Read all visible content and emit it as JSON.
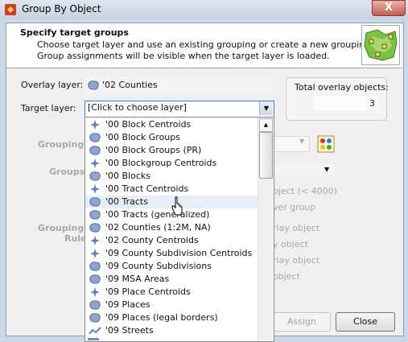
{
  "window": {
    "title": "Group By Object",
    "close_glyph": "X"
  },
  "header": {
    "title": "Specify target groups",
    "line1": "Choose target layer and use an existing grouping or create a new grouping.",
    "line2": "Group assignments will be visible when the target layer is loaded.",
    "icon": "map-grouping-icon"
  },
  "overlay": {
    "label": "Overlay layer:",
    "value": "'02 Counties",
    "icon": "polygon-layer-icon"
  },
  "total": {
    "label": "Total overlay objects:",
    "value": "3"
  },
  "target": {
    "label": "Target layer:",
    "value": "[Click to choose layer]"
  },
  "behind": {
    "grouping_label": "Grouping",
    "groups_label": "Groups",
    "grouping_rules_label1": "Grouping",
    "grouping_rules_label2": "Rule",
    "opt1": "bject (< 4000)",
    "opt2": "ver group",
    "opt3": "rlay object",
    "opt4": "y object",
    "opt5": "rlay object",
    "opt6": "object"
  },
  "layer_list": [
    {
      "label": "'00 Block Centroids",
      "icon": "point-layer-icon",
      "selected": false
    },
    {
      "label": "'00 Block Groups",
      "icon": "polygon-layer-icon",
      "selected": false
    },
    {
      "label": "'00 Block Groups (PR)",
      "icon": "polygon-layer-icon",
      "selected": false
    },
    {
      "label": "'00 Blockgroup Centroids",
      "icon": "point-layer-icon",
      "selected": false
    },
    {
      "label": "'00 Blocks",
      "icon": "polygon-layer-icon",
      "selected": false
    },
    {
      "label": "'00 Tract Centroids",
      "icon": "point-layer-icon",
      "selected": false
    },
    {
      "label": "'00 Tracts",
      "icon": "polygon-layer-icon",
      "selected": true
    },
    {
      "label": "'00 Tracts (generalized)",
      "icon": "polygon-layer-icon",
      "selected": false
    },
    {
      "label": "'02 Counties (1:2M, NA)",
      "icon": "polygon-layer-icon",
      "selected": false
    },
    {
      "label": "'02 County Centroids",
      "icon": "point-layer-icon",
      "selected": false
    },
    {
      "label": "'09 County Subdivision Centroids",
      "icon": "point-layer-icon",
      "selected": false
    },
    {
      "label": "'09 County Subdivisions",
      "icon": "polygon-layer-icon",
      "selected": false
    },
    {
      "label": "'09 MSA Areas",
      "icon": "polygon-layer-icon",
      "selected": false
    },
    {
      "label": "'09 Place Centroids",
      "icon": "point-layer-icon",
      "selected": false
    },
    {
      "label": "'09 Places",
      "icon": "polygon-layer-icon",
      "selected": false
    },
    {
      "label": "'09 Places (legal borders)",
      "icon": "polygon-layer-icon",
      "selected": false
    },
    {
      "label": "'09 Streets",
      "icon": "line-layer-icon",
      "selected": false
    }
  ],
  "buttons": {
    "assign": "Assign",
    "close": "Close"
  },
  "colors": {
    "accent": "#3a7fc6",
    "selection": "#e5eef9",
    "disabled_text": "#a8a8a8"
  }
}
